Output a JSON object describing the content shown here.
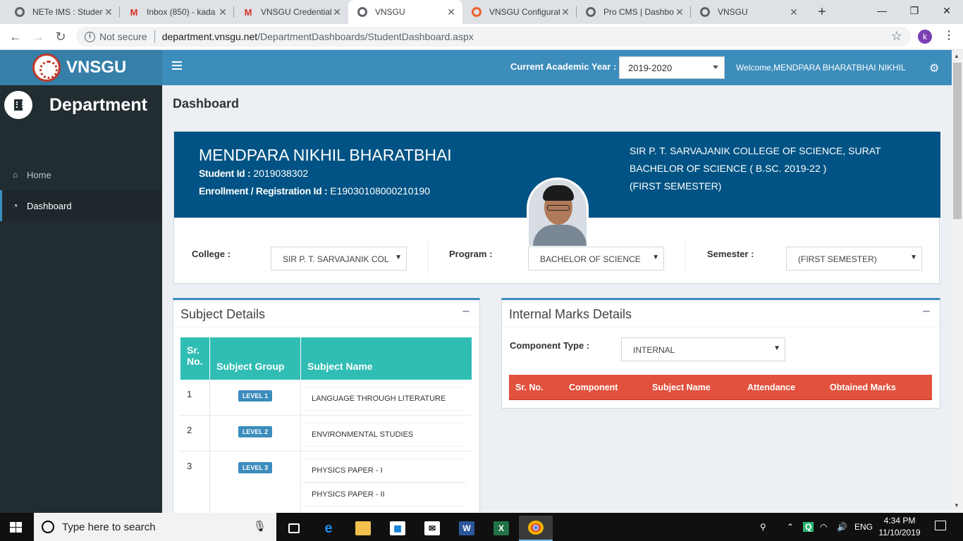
{
  "browser": {
    "tabs": [
      {
        "title": "NETe IMS : Studen",
        "icon": "globe-icon"
      },
      {
        "title": "Inbox (850) - kada",
        "icon": "gmail-icon"
      },
      {
        "title": "VNSGU Credential",
        "icon": "gmail-icon"
      },
      {
        "title": "VNSGU",
        "icon": "globe-icon"
      },
      {
        "title": "VNSGU Configurat",
        "icon": "settings-icon"
      },
      {
        "title": "Pro CMS | Dashbo",
        "icon": "globe-icon"
      },
      {
        "title": "VNSGU",
        "icon": "globe-icon"
      }
    ],
    "active_tab_index": 3,
    "address": {
      "security": "Not secure",
      "host": "department.vnsgu.net",
      "path": "/DepartmentDashboards/StudentDashboard.aspx"
    },
    "profile_initial": "k"
  },
  "header": {
    "logo_text": "VNSGU",
    "academic_year_label": "Current Academic Year :",
    "academic_year_value": "2019-2020",
    "welcome": "Welcome,MENDPARA BHARATBHAI NIKHIL"
  },
  "sidebar": {
    "title": "Department",
    "items": [
      {
        "label": "Home",
        "icon": "home-icon",
        "active": false
      },
      {
        "label": "Dashboard",
        "icon": "dashboard-icon",
        "active": true
      }
    ]
  },
  "page_title": "Dashboard",
  "student": {
    "name": "MENDPARA NIKHIL BHARATBHAI",
    "student_id_label": "Student Id :",
    "student_id": "2019038302",
    "enrollment_label": "Enrollment / Registration Id :",
    "enrollment_id": "E19030108000210190",
    "college_line": "SIR P. T. SARVAJANIK COLLEGE OF SCIENCE, SURAT",
    "program_line": "BACHELOR OF SCIENCE ( B.SC. 2019-22 )",
    "semester_line": "(FIRST SEMESTER)"
  },
  "filters": {
    "college_label": "College :",
    "college_value": "SIR P. T. SARVAJANIK COL",
    "program_label": "Program :",
    "program_value": "BACHELOR OF SCIENCE",
    "semester_label": "Semester :",
    "semester_value": "(FIRST SEMESTER)"
  },
  "subject_details": {
    "title": "Subject Details",
    "columns": [
      "Sr. No.",
      "Subject Group",
      "Subject Name"
    ],
    "rows": [
      {
        "sr": "1",
        "group": "LEVEL 1",
        "subjects": [
          "LANGUAGE THROUGH LITERATURE"
        ]
      },
      {
        "sr": "2",
        "group": "LEVEL 2",
        "subjects": [
          "ENVIRONMENTAL STUDIES"
        ]
      },
      {
        "sr": "3",
        "group": "LEVEL 3",
        "subjects": [
          "PHYSICS PAPER - I",
          "PHYSICS PAPER - II"
        ]
      }
    ]
  },
  "internal_marks": {
    "title": "Internal Marks Details",
    "component_type_label": "Component Type :",
    "component_type_value": "INTERNAL",
    "columns": [
      "Sr. No.",
      "Component",
      "Subject Name",
      "Attendance",
      "Obtained Marks"
    ]
  },
  "taskbar": {
    "search_placeholder": "Type here to search",
    "language": "ENG",
    "time": "4:34 PM",
    "date": "11/10/2019"
  },
  "colors": {
    "header_blue": "#3c8dbc",
    "logo_blue": "#367fa9",
    "profile_banner": "#005384",
    "table_header_teal": "#2fbdb4",
    "marks_header_red": "#e1513d",
    "sidebar_dark": "#222d32"
  }
}
